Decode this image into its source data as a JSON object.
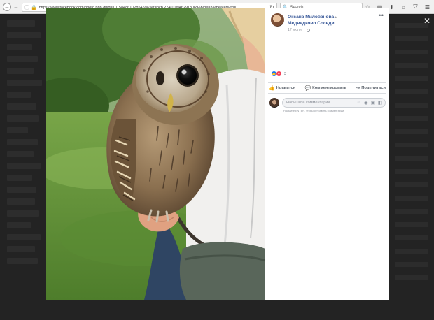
{
  "browser": {
    "url": "https://www.facebook.com/photo.php?fbid=1015848610285459&set=pcb.2740109462913069&type=3&theater&ifg=1",
    "search_placeholder": "Search"
  },
  "post": {
    "author": "Оксана Милованова",
    "group": "Медведково.Соседи.",
    "date": "17 июля",
    "reaction_count": "3",
    "actions": [
      "Нравится",
      "Комментировать",
      "Поделиться"
    ],
    "comment_placeholder": "Напишите комментарий...",
    "comment_hint": "Нажмите ENTER, чтобы отправить комментарий."
  }
}
